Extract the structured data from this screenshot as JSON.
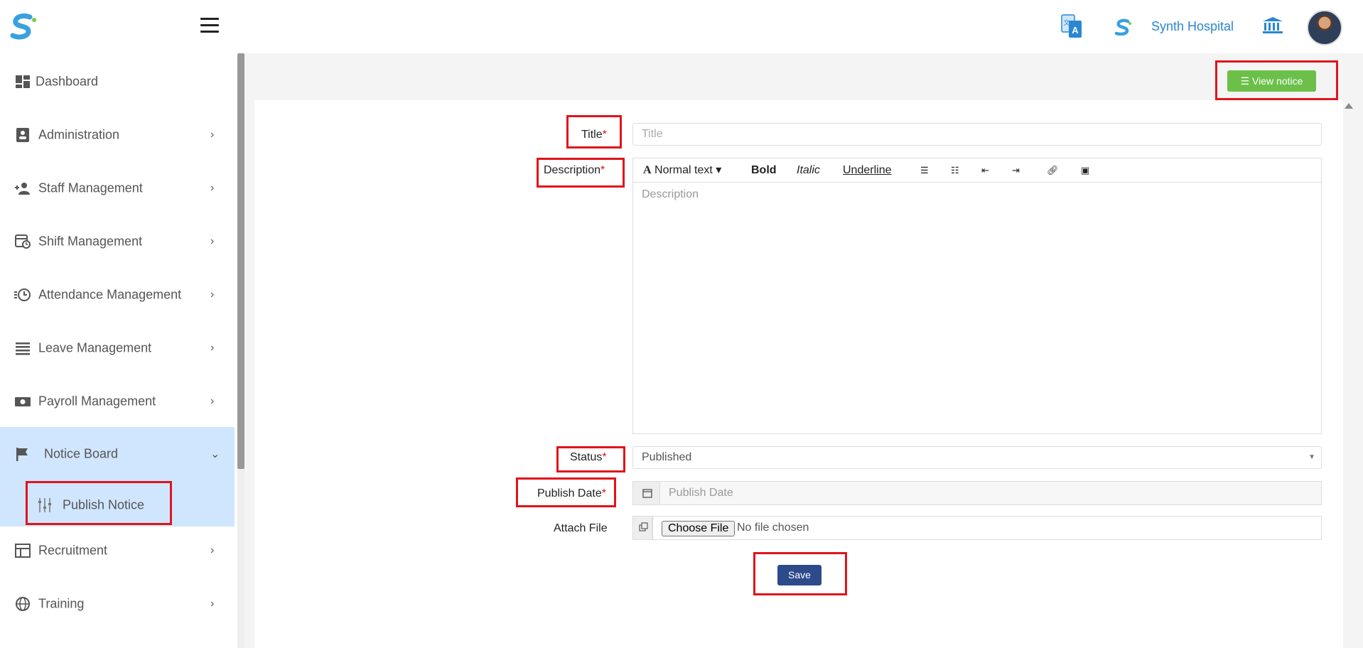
{
  "header": {
    "hospital_name": "Synth Hospital",
    "icons": [
      "logo-icon",
      "menu-icon",
      "translate-icon",
      "brand-icon",
      "bank-icon",
      "avatar"
    ]
  },
  "sidebar": {
    "items": [
      {
        "label": "Dashboard",
        "icon": "dashboard-icon",
        "has_chevron": false
      },
      {
        "label": "Administration",
        "icon": "id-card-icon",
        "has_chevron": true
      },
      {
        "label": "Staff Management",
        "icon": "users-icon",
        "has_chevron": true
      },
      {
        "label": "Shift Management",
        "icon": "calendar-clock-icon",
        "has_chevron": true
      },
      {
        "label": "Attendance Management",
        "icon": "history-icon",
        "has_chevron": true
      },
      {
        "label": "Leave Management",
        "icon": "list-icon",
        "has_chevron": true
      },
      {
        "label": "Payroll Management",
        "icon": "money-icon",
        "has_chevron": true
      },
      {
        "label": "Notice Board",
        "icon": "flag-icon",
        "has_chevron": true,
        "expanded": true
      },
      {
        "label": "Recruitment",
        "icon": "table-icon",
        "has_chevron": true
      },
      {
        "label": "Training",
        "icon": "globe-icon",
        "has_chevron": true
      }
    ],
    "sub_item": {
      "label": "Publish Notice",
      "icon": "sliders-icon"
    }
  },
  "main": {
    "view_notice_label": "View notice",
    "form": {
      "title_label": "Title",
      "title_placeholder": "Title",
      "description_label": "Description",
      "description_placeholder": "Description",
      "toolbar": {
        "normal_text": "Normal text",
        "bold": "Bold",
        "italic": "Italic",
        "underline": "Underline"
      },
      "status_label": "Status",
      "status_value": "Published",
      "publish_date_label": "Publish Date",
      "publish_date_placeholder": "Publish Date",
      "attach_file_label": "Attach File",
      "choose_file_label": "Choose File",
      "no_file_text": "No file chosen",
      "required_mark": "*",
      "save_label": "Save"
    }
  },
  "colors": {
    "accent_blue": "#2b87d1",
    "active_bg": "#d0e6ff",
    "view_notice_green": "#6cc04a",
    "save_navy": "#2d4a8a",
    "highlight_red": "#e0141b"
  }
}
